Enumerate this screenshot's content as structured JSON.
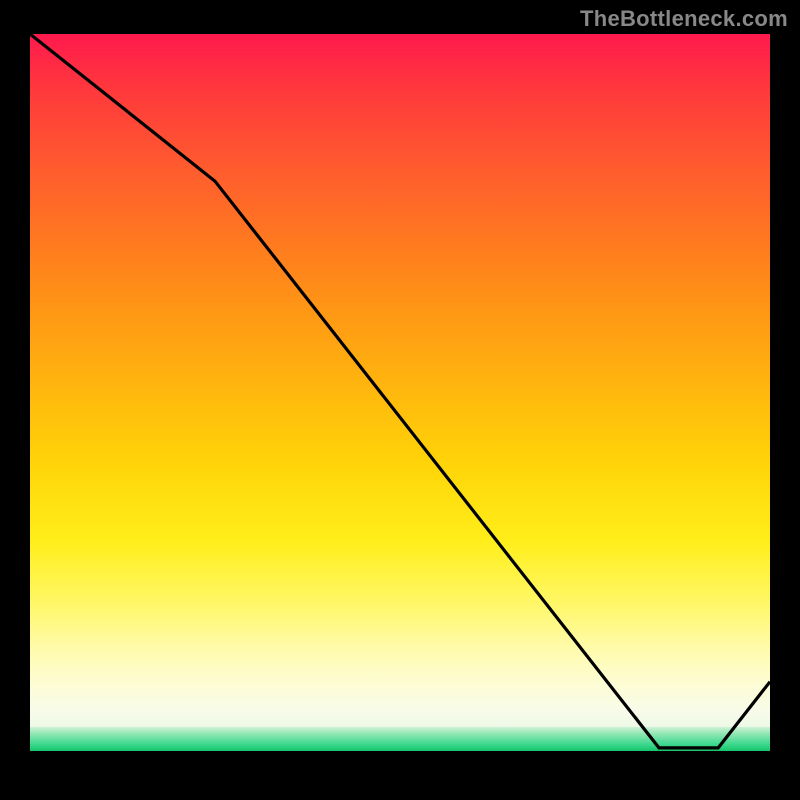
{
  "attribution": "TheBottleneck.com",
  "marker_label": "",
  "chart_data": {
    "type": "line",
    "title": "",
    "xlabel": "",
    "ylabel": "",
    "xlim": [
      0,
      100
    ],
    "ylim": [
      0,
      100
    ],
    "series": [
      {
        "name": "bottleneck-curve",
        "x": [
          0,
          25,
          85,
          93,
          100
        ],
        "y": [
          100,
          80,
          3,
          3,
          12
        ]
      }
    ],
    "annotations": [
      {
        "name": "optimal-marker",
        "x": 89,
        "y": 4
      }
    ],
    "background_gradient": {
      "stops": [
        {
          "pct": 0,
          "color": "#ff1a4d"
        },
        {
          "pct": 50,
          "color": "#ffb80d"
        },
        {
          "pct": 84,
          "color": "#fffbb0"
        },
        {
          "pct": 94,
          "color": "#ecf9e6"
        },
        {
          "pct": 97,
          "color": "#17c56c"
        },
        {
          "pct": 97.4,
          "color": "#000000"
        }
      ]
    }
  }
}
